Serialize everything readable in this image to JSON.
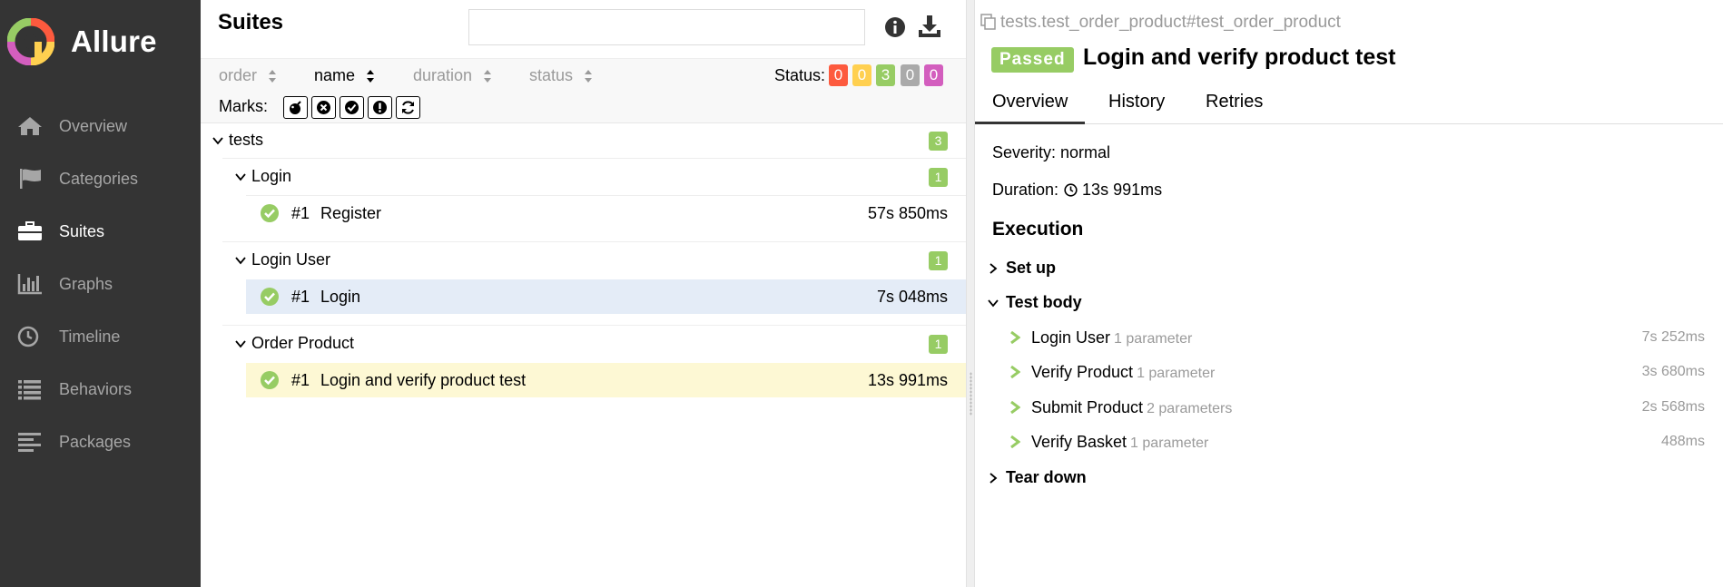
{
  "brand": {
    "name": "Allure"
  },
  "sidebar": {
    "items": [
      {
        "label": "Overview",
        "icon": "home-icon"
      },
      {
        "label": "Categories",
        "icon": "flag-icon"
      },
      {
        "label": "Suites",
        "icon": "briefcase-icon",
        "active": true
      },
      {
        "label": "Graphs",
        "icon": "bar-chart-icon"
      },
      {
        "label": "Timeline",
        "icon": "clock-icon"
      },
      {
        "label": "Behaviors",
        "icon": "list-icon"
      },
      {
        "label": "Packages",
        "icon": "align-left-icon"
      }
    ]
  },
  "suites": {
    "title": "Suites",
    "search": {
      "value": "",
      "placeholder": ""
    },
    "sort": [
      "order",
      "name",
      "duration",
      "status"
    ],
    "active_sort": "name",
    "status_label": "Status:",
    "status_counts": [
      {
        "value": "0",
        "color": "#fd5a3e"
      },
      {
        "value": "0",
        "color": "#ffd050"
      },
      {
        "value": "3",
        "color": "#97cc64"
      },
      {
        "value": "0",
        "color": "#aaaaaa"
      },
      {
        "value": "0",
        "color": "#d35ebe"
      }
    ],
    "marks_label": "Marks:",
    "marks": [
      "bomb-icon",
      "times-circle-icon",
      "check-circle-icon",
      "exclamation-icon",
      "refresh-icon"
    ],
    "tree": {
      "root": {
        "label": "tests",
        "count": "3"
      },
      "groups": [
        {
          "label": "Login",
          "count": "1",
          "test": {
            "num": "#1",
            "name": "Register",
            "duration": "57s 850ms"
          }
        },
        {
          "label": "Login User",
          "count": "1",
          "test": {
            "num": "#1",
            "name": "Login",
            "duration": "7s 048ms"
          }
        },
        {
          "label": "Order Product",
          "count": "1",
          "test": {
            "num": "#1",
            "name": "Login and verify product test",
            "duration": "13s 991ms"
          }
        }
      ]
    }
  },
  "detail": {
    "full_name": "tests.test_order_product#test_order_product",
    "status": "Passed",
    "title": "Login and verify product test",
    "tabs": [
      "Overview",
      "History",
      "Retries"
    ],
    "severity": "Severity: normal",
    "duration_label": "Duration:",
    "duration": "13s 991ms",
    "execution_title": "Execution",
    "setup": "Set up",
    "body": "Test body",
    "teardown": "Tear down",
    "steps": [
      {
        "name": "Login User",
        "params": "1 parameter",
        "duration": "7s 252ms"
      },
      {
        "name": "Verify Product",
        "params": "1 parameter",
        "duration": "3s 680ms"
      },
      {
        "name": "Submit Product",
        "params": "2 parameters",
        "duration": "2s 568ms"
      },
      {
        "name": "Verify Basket",
        "params": "1 parameter",
        "duration": "488ms"
      }
    ]
  },
  "colors": {
    "sidebar": "#343434",
    "passed": "#97cc64",
    "accent": "#68b5e0",
    "highlight": "#fdf8d4",
    "selected": "#e4ecf7"
  }
}
